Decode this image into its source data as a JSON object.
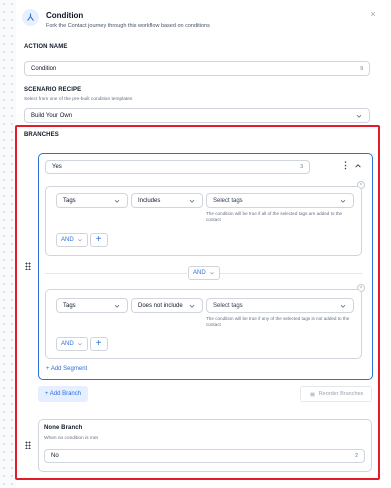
{
  "header": {
    "title": "Condition",
    "subtitle": "Fork the Contact journey through this workflow based on conditions",
    "close_symbol": "×"
  },
  "action_name": {
    "label": "ACTION NAME",
    "value": "Condition",
    "count": "9"
  },
  "scenario_recipe": {
    "label": "SCENARIO RECIPE",
    "helper": "Select from one of the pre-built condition templates",
    "value": "Build Your Own"
  },
  "branches": {
    "label": "BRANCHES",
    "branch": {
      "name": "Yes",
      "count": "3",
      "segments": [
        {
          "field": "Tags",
          "operator": "Includes",
          "value_placeholder": "Select tags",
          "note": "The condition will be true if all of the selected tags are added to the contact",
          "and_label": "AND",
          "plus": "+"
        },
        {
          "field": "Tags",
          "operator": "Does not include",
          "value_placeholder": "Select tags",
          "note": "The condition will be true if any of the selected tags is not added to the contact",
          "and_label": "AND",
          "plus": "+"
        }
      ],
      "join_label": "AND",
      "add_segment": "+ Add Segment"
    },
    "add_branch": "+ Add Branch",
    "reorder": "Reorder Branches",
    "none_branch": {
      "title": "None Branch",
      "helper": "When no condition is met",
      "value": "No",
      "count": "2"
    }
  },
  "colors": {
    "accent": "#2e6fd8",
    "highlight": "#e11d2a"
  }
}
